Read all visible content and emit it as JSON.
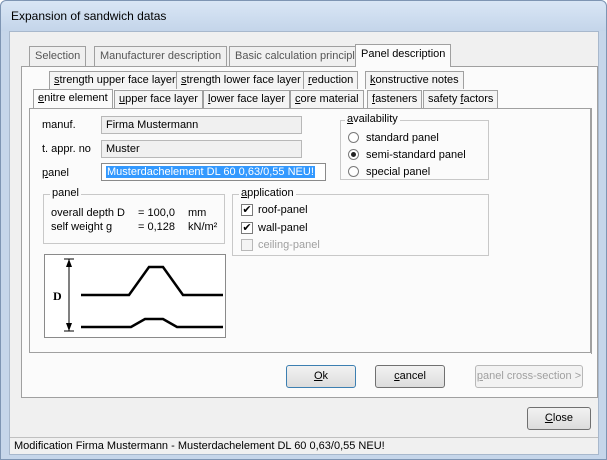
{
  "window": {
    "title": "Expansion of sandwich datas"
  },
  "tabs": [
    {
      "label": "Selection"
    },
    {
      "label": "Manufacturer description"
    },
    {
      "label": "Basic calculation principle"
    },
    {
      "label": "Panel description"
    }
  ],
  "subtabs_row1": [
    {
      "pre": "",
      "u": "s",
      "post": "trength upper face layer"
    },
    {
      "pre": "",
      "u": "s",
      "post": "trength lower face layer"
    },
    {
      "pre": "",
      "u": "r",
      "post": "eduction"
    },
    {
      "pre": "",
      "u": "k",
      "post": "onstructive notes"
    }
  ],
  "subtabs_row2": [
    {
      "pre": "",
      "u": "e",
      "post": "nitre element"
    },
    {
      "pre": "",
      "u": "u",
      "post": "pper face layer"
    },
    {
      "pre": "",
      "u": "l",
      "post": "ower face layer"
    },
    {
      "pre": "",
      "u": "c",
      "post": "ore material"
    },
    {
      "pre": "",
      "u": "f",
      "post": "asteners"
    },
    {
      "pre": "safety ",
      "u": "f",
      "post": "actors"
    }
  ],
  "form": {
    "manuf_label": "manuf.",
    "manuf_value": "Firma Mustermann",
    "appr_label": "t. appr. no",
    "appr_value": "Muster",
    "panel_label_u": "p",
    "panel_label_rest": "anel",
    "panel_value": "Musterdachelement DL 60 0,63/0,55 NEU!"
  },
  "availability": {
    "legend_u": "a",
    "legend_rest": "vailability",
    "options": [
      {
        "label": "standard panel",
        "selected": false
      },
      {
        "label": "semi-standard panel",
        "selected": true
      },
      {
        "label": "special panel",
        "selected": false
      }
    ]
  },
  "panel_group": {
    "legend": "panel",
    "depth_label": "overall depth D",
    "depth_value": "= 100,0",
    "depth_unit": "mm",
    "weight_label": "self weight g",
    "weight_value": "= 0,128",
    "weight_unit": "kN/m²"
  },
  "application": {
    "legend_u": "a",
    "legend_rest": "pplication",
    "items": [
      {
        "label": "roof-panel",
        "checked": true,
        "enabled": true
      },
      {
        "label": "wall-panel",
        "checked": true,
        "enabled": true
      },
      {
        "label": "ceiling-panel",
        "checked": false,
        "enabled": false
      }
    ]
  },
  "diagram": {
    "dimension_label": "D"
  },
  "buttons": {
    "ok_u": "O",
    "ok_rest": "k",
    "cancel_u": "c",
    "cancel_rest": "ancel",
    "cross_u": "p",
    "cross_rest": "anel cross-section >",
    "close_u": "C",
    "close_rest": "lose"
  },
  "status": {
    "text": "Modification Firma Mustermann - Musterdachelement DL 60 0,63/0,55 NEU!"
  }
}
